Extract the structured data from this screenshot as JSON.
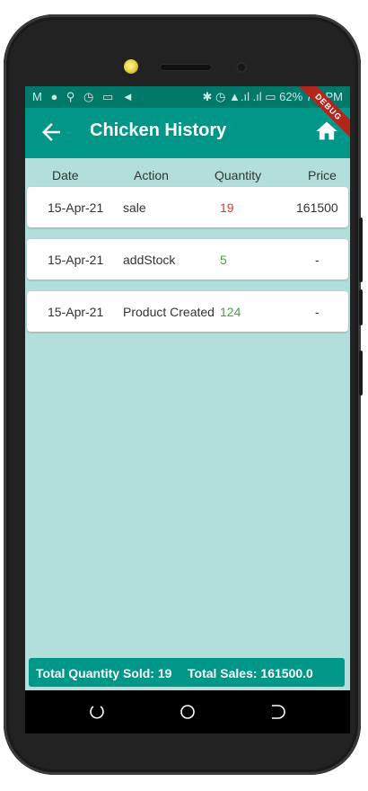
{
  "status": {
    "left_icons": "M ● ⚲ ◷ ▭ ◄",
    "right_text": "✱ ◷ ▲.ıl .ıl ▭ 62% 7:2 PM"
  },
  "appbar": {
    "title": "Chicken History",
    "back_icon": "arrow-back-icon",
    "home_icon": "home-icon",
    "debug_banner": "DEBUG"
  },
  "table": {
    "headers": [
      "Date",
      "Action",
      "Quantity",
      "Price"
    ],
    "rows": [
      {
        "date": "15-Apr-21",
        "action": "sale",
        "quantity": "19",
        "price": "161500"
      },
      {
        "date": "15-Apr-21",
        "action": "addStock",
        "quantity": "5",
        "price": "-"
      },
      {
        "date": "15-Apr-21",
        "action": "Product Created",
        "quantity": "124",
        "price": "-"
      }
    ]
  },
  "summary": {
    "total_quantity": "Total Quantity Sold: 19",
    "total_sales": "Total Sales: 161500.0"
  },
  "colors": {
    "appbar": "#009688",
    "statusbar": "#00796b",
    "background": "#b2dfdb",
    "negative_qty": "#e53935",
    "positive_qty": "#43a047"
  }
}
